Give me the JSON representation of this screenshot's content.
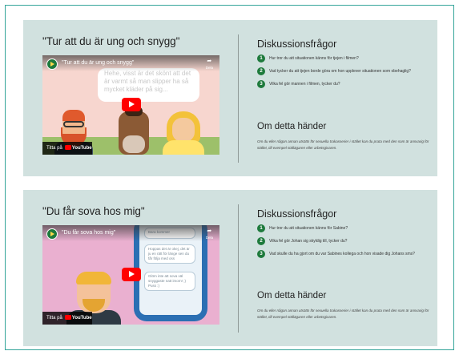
{
  "cards": [
    {
      "title": "\"Tur att du är ung och snygg\"",
      "video": {
        "title": "\"Tur att du är ung och snygg\"",
        "share_label": "Dela",
        "watch_on": "Titta på",
        "platform": "YouTube",
        "bubble_text": "Hehe, visst är det skönt att det är varmt så man slipper ha så mycket kläder på sig...",
        "messages": []
      },
      "questions_heading": "Diskussionsfrågor",
      "questions": [
        "Hur tror du att situationen känns för tjejen i filmen?",
        "Vad tycker du att tjejen borde göra om hon upplever situationen som obehaglig?",
        "Vilka fel gör mannen i filmen, tycker du?"
      ],
      "about_heading": "Om detta händer",
      "about_text": "Om du eller någon annan utsätts för sexuella trakasserier i stället kan du prata med den som är ansvarig för stället, till exempel ställägaren eller arbetsgivaren."
    },
    {
      "title": "\"Du får sova hos mig\"",
      "video": {
        "title": "\"Du får sova hos mig\"",
        "share_label": "Dela",
        "watch_on": "Titta på",
        "platform": "YouTube",
        "bubble_text": "",
        "messages": [
          "Bara kommer",
          "Hoppas det är okej, det är ju en rätt för länge sen du får följa med oss",
          "Glöm inte att sova väl snyggaste natt imorn! ;) Puss :)"
        ]
      },
      "questions_heading": "Diskussionsfrågor",
      "questions": [
        "Hur tror du att situationen känns för Sabine?",
        "Vilka fel gör Johan sig skyldig till, tycker du?",
        "Vad skulle du ha gjort om du var Sabines kollega och hon visade dig Johans sms?"
      ],
      "about_heading": "Om detta händer",
      "about_text": "Om du eller någon annan utsätts för sexuella trakasserier i stället kan du prata med den som är ansvarig för stället, till exempel ställägaren eller arbetsgivaren."
    }
  ],
  "colors": {
    "card_bg": "#d1e1df",
    "accent_green": "#1e7a3c",
    "frame_border": "#35a59a",
    "youtube_red": "#ff0000"
  }
}
